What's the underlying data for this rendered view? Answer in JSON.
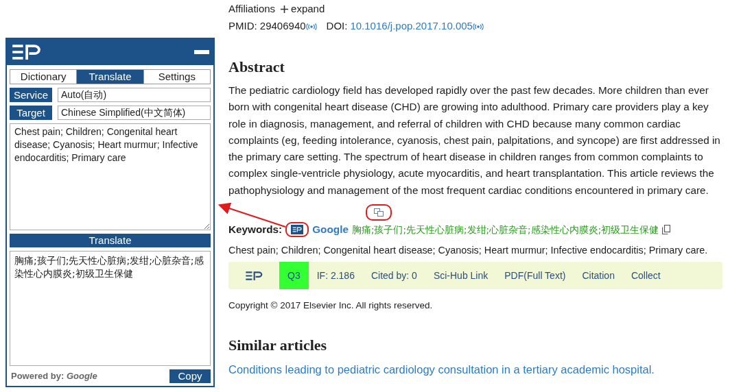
{
  "panel": {
    "tabs": [
      {
        "label": "Dictionary",
        "selected": false
      },
      {
        "label": "Translate",
        "selected": true
      },
      {
        "label": "Settings",
        "selected": false
      }
    ],
    "fields": [
      {
        "label": "Service",
        "value": "Auto(自动)"
      },
      {
        "label": "Target",
        "value": "Chinese Simplified(中文简体)"
      }
    ],
    "source_text": "Chest pain; Children; Congenital heart disease; Cyanosis; Heart murmur; Infective endocarditis; Primary care",
    "translate_button": "Translate",
    "result_text": "胸痛;孩子们;先天性心脏病;发绀;心脏杂音;感染性心内膜炎;初级卫生保健",
    "powered_by": "Powered by:",
    "powered_by_service": "Google",
    "copy_button": "Copy"
  },
  "article": {
    "affiliations": "Affiliations",
    "expand": "expand",
    "pmid": "PMID: 29406940",
    "doi_label": "DOI:",
    "doi": "10.1016/j.pop.2017.10.005",
    "abstract_heading": "Abstract",
    "abstract": "The pediatric cardiology field has developed rapidly over the past few decades. More children than ever born with congenital heart disease (CHD) are growing into adulthood. Primary care providers play a key role in diagnosis, management, and referral of children with CHD because many common cardiac complaints (eg, feeding intolerance, cyanosis, chest pain, palpitations, and syncope) are first addressed in the primary care setting. The spectrum of heart disease in children ranges from common complaints to complex single-ventricle physiology, acute myocarditis, and heart transplantation. This article reviews the pathophysiology and management of the most frequent cardiac conditions encountered in primary care.",
    "keywords_label": "Keywords:",
    "keywords_service": "Google",
    "keywords_translation": "胸痛;孩子们;先天性心脏病;发绀;心脏杂音;感染性心内膜炎;初级卫生保健",
    "keywords": "Chest pain; Children; Congenital heart disease; Cyanosis; Heart murmur; Infective endocarditis; Primary care.",
    "toolbar": [
      {
        "label": "Q3",
        "kind": "quartile"
      },
      {
        "label": "IF: 2.186",
        "kind": "info"
      },
      {
        "label": "Cited by: 0",
        "kind": "info"
      },
      {
        "label": "Sci-Hub Link",
        "kind": "link"
      },
      {
        "label": "PDF(Full Text)",
        "kind": "link"
      },
      {
        "label": "Citation",
        "kind": "link"
      },
      {
        "label": "Collect",
        "kind": "link"
      }
    ],
    "copyright": "Copyright © 2017 Elsevier Inc. All rights reserved.",
    "similar_heading": "Similar articles",
    "similar": [
      "Conditions leading to pediatric cardiology consultation in a tertiary academic hospital."
    ]
  }
}
